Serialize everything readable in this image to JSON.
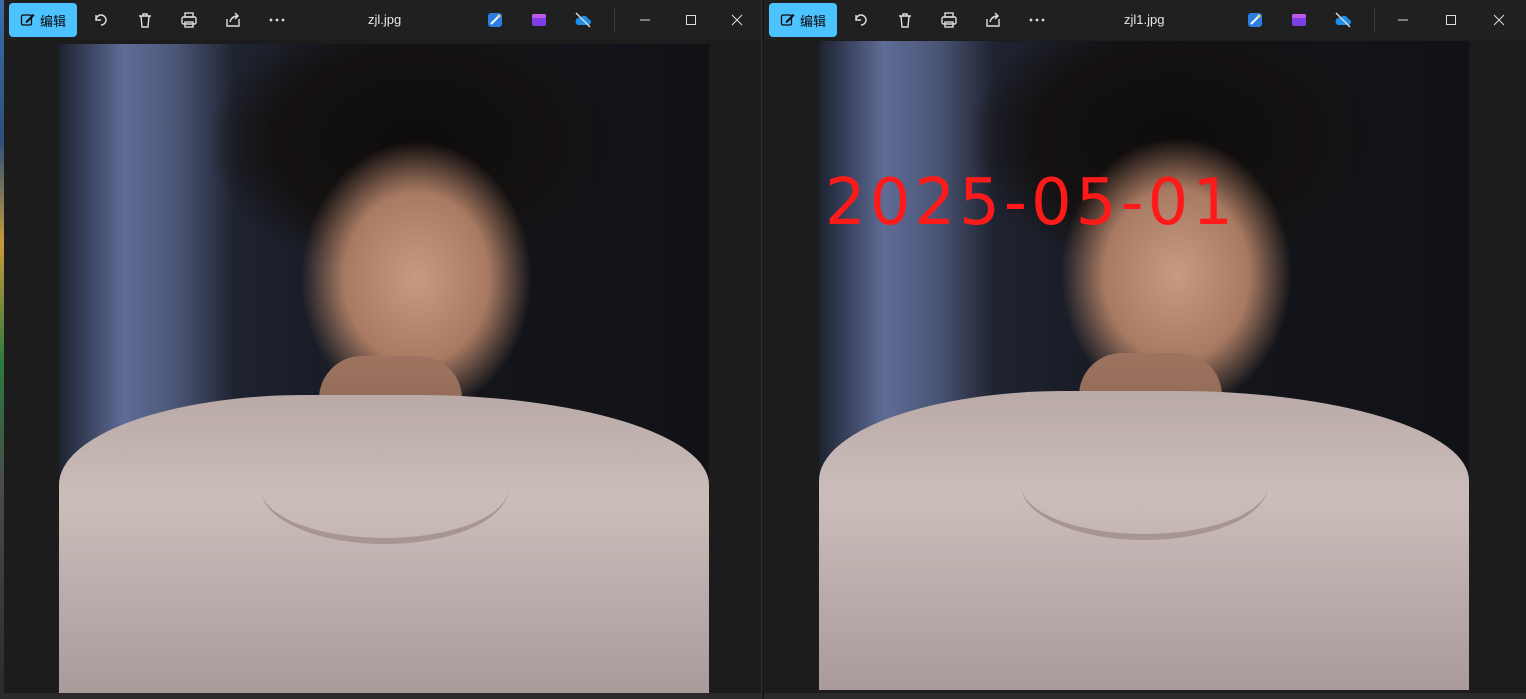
{
  "left_window": {
    "edit_label": "编辑",
    "title": "zjl.jpg",
    "icons": [
      "edit-icon",
      "rotate-icon",
      "delete-icon",
      "print-icon",
      "share-icon",
      "more-icon",
      "designer-icon",
      "clipchamp-icon",
      "onedrive-icon"
    ]
  },
  "right_window": {
    "edit_label": "编辑",
    "title": "zjl1.jpg",
    "date_stamp": "2025-05-01",
    "date_stamp_color": "#ff1a1a",
    "icons": [
      "edit-icon",
      "rotate-icon",
      "delete-icon",
      "print-icon",
      "share-icon",
      "more-icon",
      "designer-icon",
      "clipchamp-icon",
      "onedrive-icon"
    ]
  },
  "colors": {
    "accent": "#4cc2ff",
    "titlebar": "#202020",
    "viewer_bg": "#1c1c1c"
  }
}
